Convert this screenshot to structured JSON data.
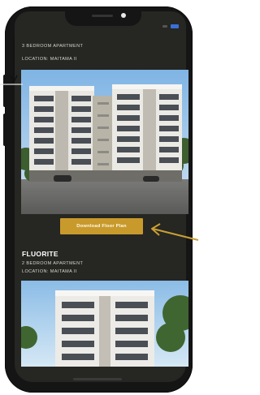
{
  "listing1": {
    "type_text": "3 BEDROOM APARTMENT",
    "location_text": "LOCATION: MAITAMA II"
  },
  "download_button": {
    "label": "Download Floor Plan"
  },
  "listing2": {
    "title": "FLUORITE",
    "type_text": "2 BEDROOM APARTMENT",
    "location_text": "LOCATION: MAITAMA II"
  },
  "colors": {
    "background": "#262622",
    "button": "#c89a2c",
    "annotation": "#c9a033",
    "phone_frame": "#151515"
  }
}
